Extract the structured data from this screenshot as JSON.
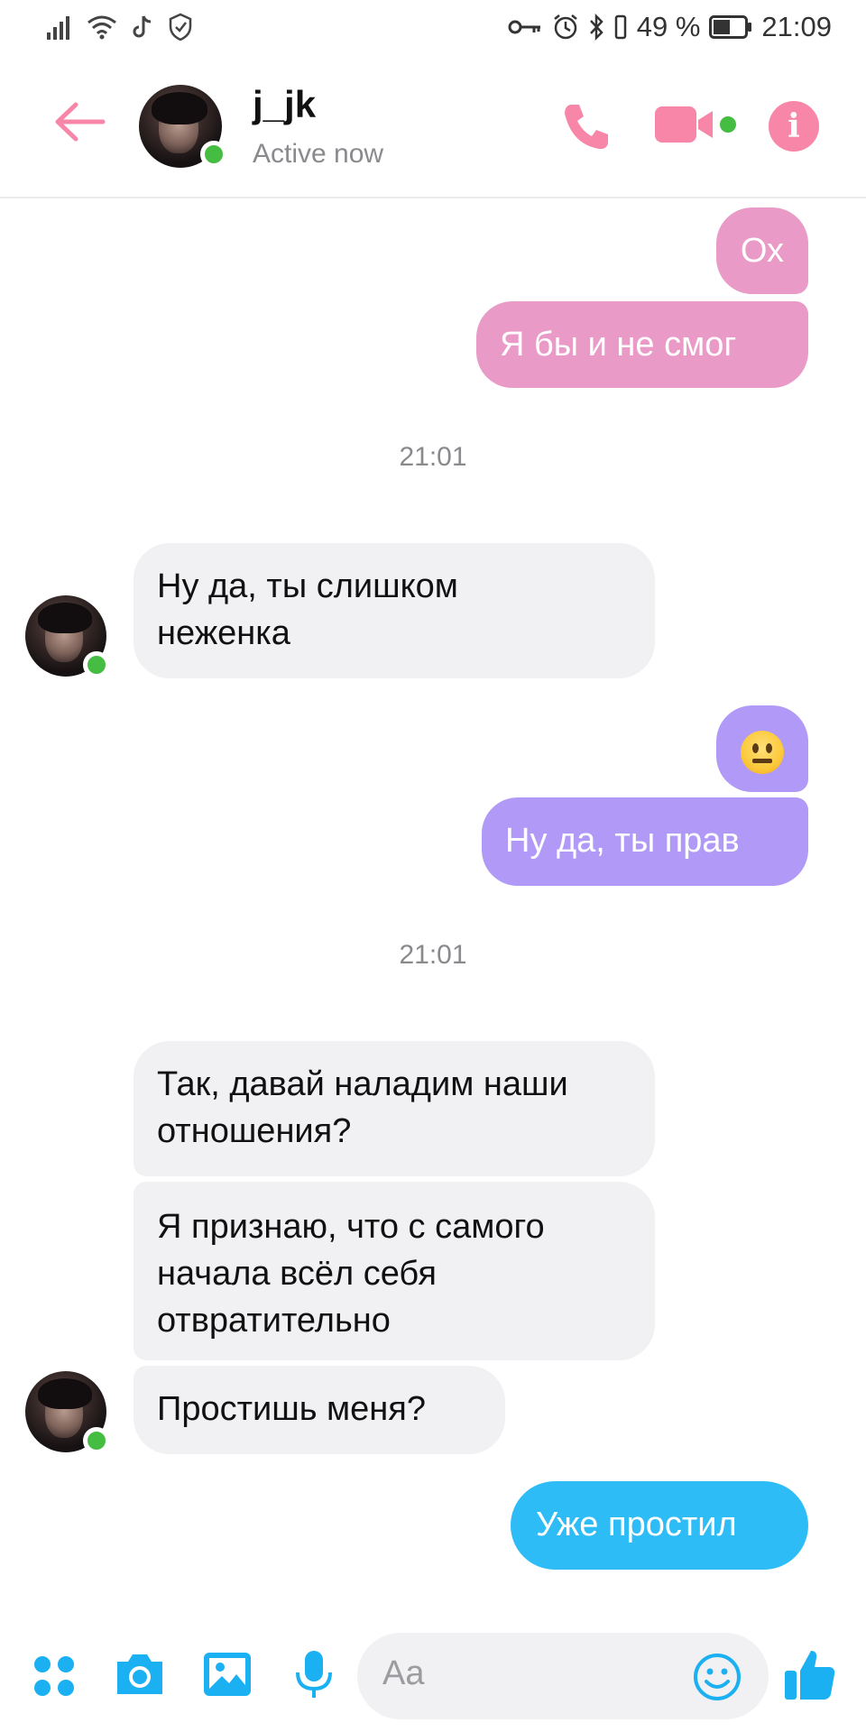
{
  "status_bar": {
    "battery": "49 %",
    "time": "21:09"
  },
  "header": {
    "contact_name": "j_jk",
    "contact_status": "Active now",
    "info_label": "i"
  },
  "colors": {
    "accent_pink": "#f786a9",
    "bubble_pink": "#e99ac7",
    "bubble_violet": "#b19af7",
    "bubble_blue": "#2ebcf7",
    "incoming_bg": "#f1f0f2",
    "online_green": "#45bd42",
    "composer_blue": "#1ab0f2"
  },
  "messages": [
    {
      "direction": "out",
      "text": "Ох"
    },
    {
      "direction": "out",
      "text": "Я бы и не смог"
    },
    {
      "type": "time",
      "text": "21:01"
    },
    {
      "direction": "in",
      "text": "Ну да, ты слишком неженка"
    },
    {
      "direction": "out",
      "emoji": "neutral-face"
    },
    {
      "direction": "out",
      "text": "Ну да, ты прав"
    },
    {
      "type": "time",
      "text": "21:01"
    },
    {
      "direction": "in",
      "text": "Так, давай наладим наши отношения?"
    },
    {
      "direction": "in",
      "text": "Я признаю, что с самого начала всёл себя отвратительно"
    },
    {
      "direction": "in",
      "text": "Простишь меня?"
    },
    {
      "direction": "out",
      "text": "Уже простил"
    }
  ],
  "composer": {
    "placeholder": "Aa",
    "icons": [
      "apps-icon",
      "camera-icon",
      "gallery-icon",
      "microphone-icon",
      "emoji-icon",
      "thumbs-up-icon"
    ]
  }
}
